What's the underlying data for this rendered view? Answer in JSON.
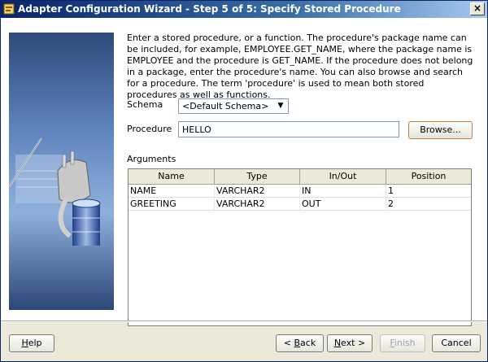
{
  "window": {
    "title": "Adapter Configuration Wizard - Step 5 of 5: Specify Stored Procedure",
    "close_label": "×"
  },
  "instructions": "Enter a stored procedure, or a function. The procedure's package name can be included, for example, EMPLOYEE.GET_NAME, where the package name is EMPLOYEE and the procedure is GET_NAME.  If the procedure does not belong in a package, enter the procedure's name. You can also browse and search for a procedure. The term 'procedure' is used to mean both stored procedures as well as functions.",
  "schema": {
    "label": "Schema",
    "selected": "<Default Schema>"
  },
  "procedure": {
    "label": "Procedure",
    "value": "HELLO",
    "browse_label": "Browse..."
  },
  "arguments": {
    "label": "Arguments",
    "columns": [
      "Name",
      "Type",
      "In/Out",
      "Position"
    ],
    "rows": [
      {
        "name": "NAME",
        "type": "VARCHAR2",
        "inout": "IN",
        "position": "1"
      },
      {
        "name": "GREETING",
        "type": "VARCHAR2",
        "inout": "OUT",
        "position": "2"
      }
    ]
  },
  "footer": {
    "help": {
      "mnemonic": "H",
      "rest": "elp"
    },
    "back": {
      "prefix": "< ",
      "mnemonic": "B",
      "rest": "ack"
    },
    "next": {
      "mnemonic": "N",
      "rest": "ext >"
    },
    "finish": {
      "mnemonic": "F",
      "rest": "inish"
    },
    "cancel": "Cancel"
  },
  "colors": {
    "title_start": "#0a246a",
    "title_end": "#a6caf0",
    "dialog_bg": "#ece9d8"
  },
  "icons": {
    "title": "wizard-icon",
    "side": "database-adapter-plug-illustration",
    "combo": "chevron-down-icon"
  }
}
